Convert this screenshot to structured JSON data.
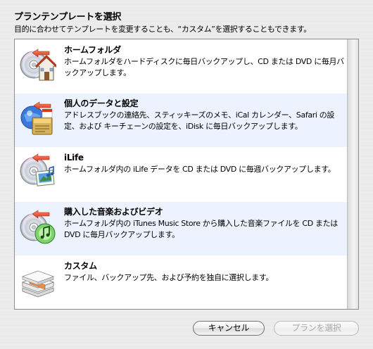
{
  "header": {
    "title": "プランテンプレートを選択",
    "subtitle": "目的に合わせてテンプレートを変更することも、“カスタム”を選択することもできます。"
  },
  "plans": [
    {
      "title": "ホームフォルダ",
      "description": "ホームフォルダをハードディスクに毎日バックアップし、CD または DVD に毎月バックアップします。",
      "icon": "home-folder-icon"
    },
    {
      "title": "個人のデータと設定",
      "description": "アドレスブックの連絡先、スティッキーズのメモ、iCal カレンダー、Safari の設定、および キーチェーンの設定を、iDisk に毎日バックアップします。",
      "icon": "personal-data-icon"
    },
    {
      "title": "iLife",
      "description": "ホームフォルダ内の iLife データを CD または DVD に毎週バックアップします。",
      "icon": "ilife-icon"
    },
    {
      "title": "購入した音楽およびビデオ",
      "description": "ホームフォルダ内の iTunes Music Store から購入した音楽ファイルを CD または DVD に毎月バックアップします。",
      "icon": "purchased-music-icon"
    },
    {
      "title": "カスタム",
      "description": "ファイル、バックアップ先、および予約を独自に選択します。",
      "icon": "custom-icon"
    }
  ],
  "buttons": {
    "cancel_label": "キャンセル",
    "select_label": "プランを選択",
    "select_enabled": false
  },
  "colors": {
    "row_alt": "#edf3fe",
    "disabled_text": "#a9a9a9"
  }
}
